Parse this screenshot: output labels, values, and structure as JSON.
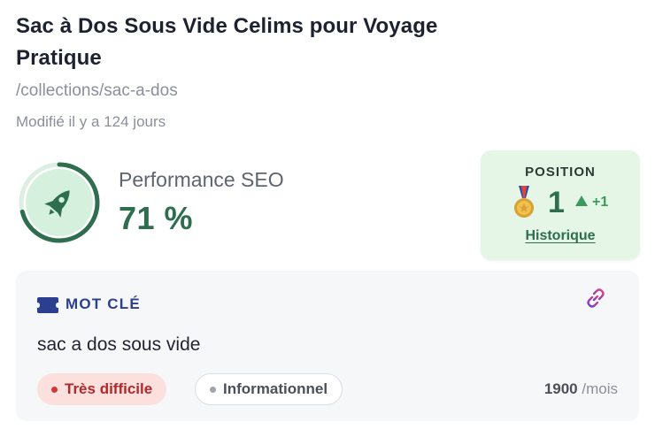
{
  "page": {
    "title": "Sac à Dos Sous Vide Celims pour Voyage Pratique",
    "url": "/collections/sac-a-dos",
    "modified": "Modifié il y a 124 jours"
  },
  "seo": {
    "label": "Performance SEO",
    "value_text": "71 %",
    "score_fraction": 0.71,
    "color": "#2e6e4f",
    "icon": "rocket-icon"
  },
  "position": {
    "label": "POSITION",
    "value": "1",
    "change": "+1",
    "history_link": "Historique",
    "medal_icon": "bronze-medal-icon",
    "background": "#e5f6e7"
  },
  "keyword": {
    "header": "MOT CLÉ",
    "value": "sac a dos sous vide",
    "difficulty": "Très difficile",
    "intent": "Informationnel",
    "volume": "1900",
    "volume_unit": "/mois",
    "header_icon": "ticket-icon",
    "link_icon": "link-icon",
    "accent": "#2c3e8f"
  }
}
